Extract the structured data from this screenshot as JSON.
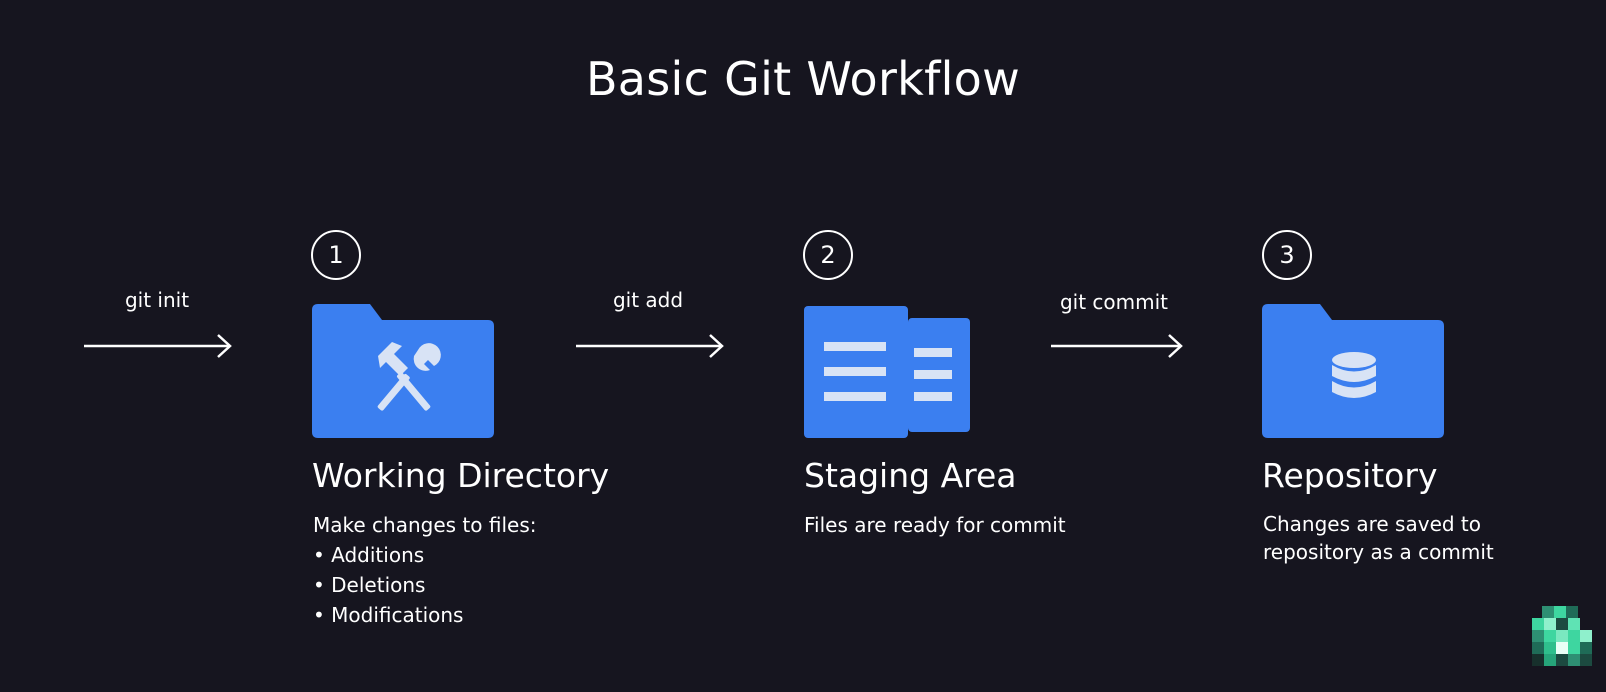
{
  "title": "Basic Git Workflow",
  "commands": {
    "init": "git init",
    "add": "git add",
    "commit": "git commit"
  },
  "stages": [
    {
      "number": "1",
      "name": "Working Directory",
      "description": "Make changes to files:",
      "bullets": [
        "Additions",
        "Deletions",
        "Modifications"
      ],
      "icon": "folder-tools-icon"
    },
    {
      "number": "2",
      "name": "Staging Area",
      "description": "Files are ready for commit",
      "icon": "documents-icon"
    },
    {
      "number": "3",
      "name": "Repository",
      "description_lines": [
        "Changes are saved to",
        "repository as a commit"
      ],
      "icon": "folder-database-icon"
    }
  ],
  "colors": {
    "background": "#16151f",
    "accent": "#3b7ff0",
    "icon_light": "#d8e3f5",
    "text": "#ffffff",
    "logo_green": "#3ed6a0"
  }
}
